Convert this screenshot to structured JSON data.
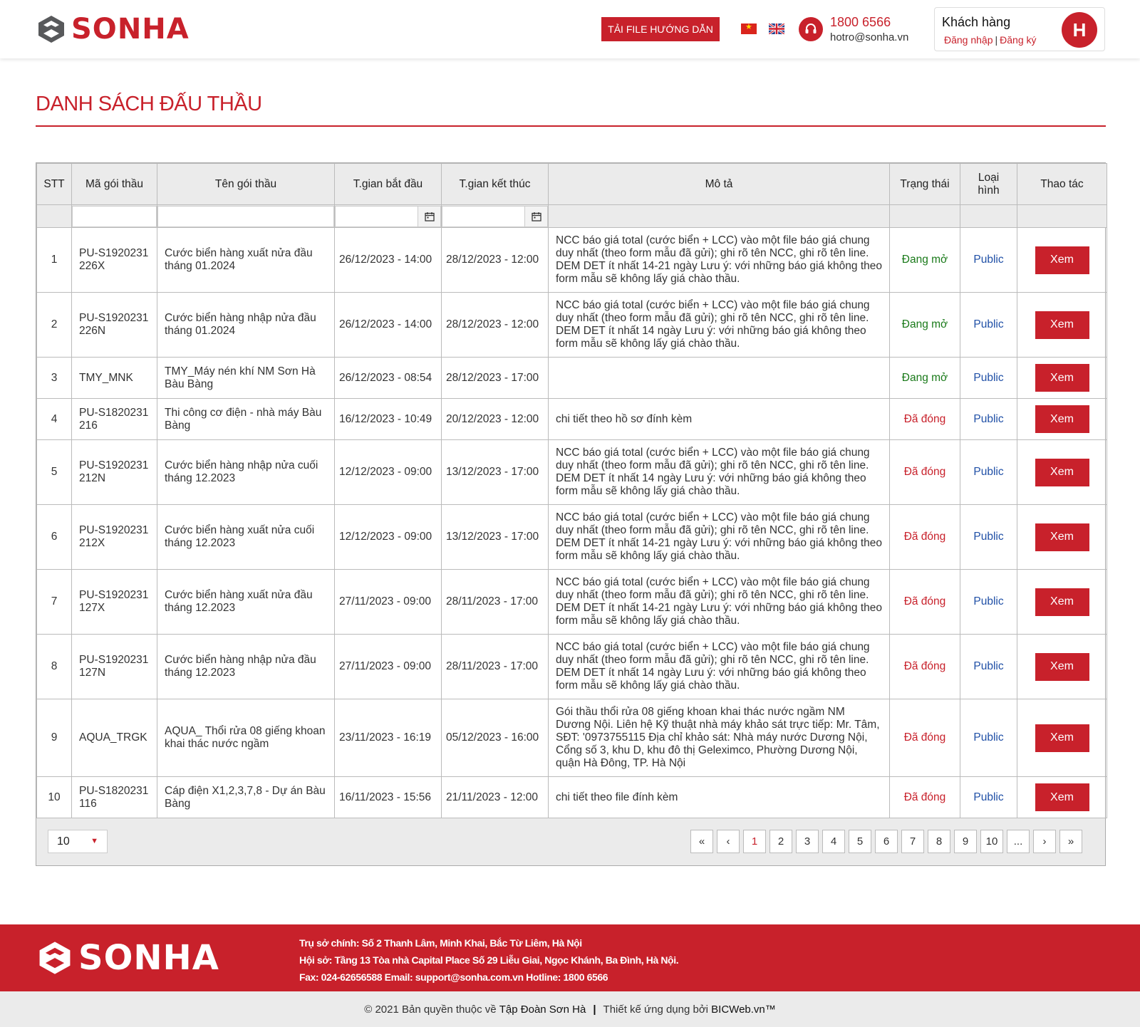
{
  "header": {
    "brand": "SONHA",
    "download_label": "TẢI FILE HƯỚNG DẪN",
    "phone": "1800 6566",
    "email": "hotro@sonha.vn",
    "user_title": "Khách hàng",
    "login_label": "Đăng nhập",
    "register_label": "Đăng ký",
    "avatar_letter": "H"
  },
  "page_title": "DANH SÁCH ĐẤU THẦU",
  "table": {
    "headers": [
      "STT",
      "Mã gói thầu",
      "Tên gói thầu",
      "T.gian bắt đầu",
      "T.gian kết thúc",
      "Mô tả",
      "Trạng thái",
      "Loại hình",
      "Thao tác"
    ],
    "view_label": "Xem",
    "rows": [
      {
        "stt": "1",
        "code": "PU-S1920231226X",
        "name": "Cước biển hàng xuất nửa đầu tháng 01.2024",
        "start": "26/12/2023 - 14:00",
        "end": "28/12/2023 - 12:00",
        "desc": "NCC báo giá total (cước biển + LCC) vào một file báo giá chung duy nhất (theo form mẫu đã gửi); ghi rõ tên NCC, ghi rõ tên line. DEM DET ít nhất 14-21 ngày Lưu ý: với những báo giá không theo form mẫu sẽ không lấy giá chào thầu.",
        "status": "Đang mở",
        "type": "Public"
      },
      {
        "stt": "2",
        "code": "PU-S1920231226N",
        "name": "Cước biển hàng nhập nửa đầu tháng 01.2024",
        "start": "26/12/2023 - 14:00",
        "end": "28/12/2023 - 12:00",
        "desc": "NCC báo giá total (cước biển + LCC) vào một file báo giá chung duy nhất (theo form mẫu đã gửi); ghi rõ tên NCC, ghi rõ tên line. DEM DET ít nhất 14 ngày Lưu ý: với những báo giá không theo form mẫu sẽ không lấy giá chào thầu.",
        "status": "Đang mở",
        "type": "Public"
      },
      {
        "stt": "3",
        "code": "TMY_MNK",
        "name": "TMY_Máy nén khí NM Sơn Hà Bàu Bàng",
        "start": "26/12/2023 - 08:54",
        "end": "28/12/2023 - 17:00",
        "desc": "",
        "status": "Đang mở",
        "type": "Public"
      },
      {
        "stt": "4",
        "code": "PU-S1820231216",
        "name": "Thi công cơ điện - nhà máy Bàu Bàng",
        "start": "16/12/2023 - 10:49",
        "end": "20/12/2023 - 12:00",
        "desc": "chi tiết theo hồ sơ đính kèm",
        "status": "Đã đóng",
        "type": "Public"
      },
      {
        "stt": "5",
        "code": "PU-S1920231212N",
        "name": "Cước biển hàng nhập nửa cuối tháng 12.2023",
        "start": "12/12/2023 - 09:00",
        "end": "13/12/2023 - 17:00",
        "desc": "NCC báo giá total (cước biển + LCC) vào một file báo giá chung duy nhất (theo form mẫu đã gửi); ghi rõ tên NCC, ghi rõ tên line. DEM DET ít nhất 14 ngày Lưu ý: với những báo giá không theo form mẫu sẽ không lấy giá chào thầu.",
        "status": "Đã đóng",
        "type": "Public"
      },
      {
        "stt": "6",
        "code": "PU-S1920231212X",
        "name": "Cước biển hàng xuất nửa cuối tháng 12.2023",
        "start": "12/12/2023 - 09:00",
        "end": "13/12/2023 - 17:00",
        "desc": "NCC báo giá total (cước biển + LCC) vào một file báo giá chung duy nhất (theo form mẫu đã gửi); ghi rõ tên NCC, ghi rõ tên line. DEM DET ít nhất 14-21 ngày Lưu ý: với những báo giá không theo form mẫu sẽ không lấy giá chào thầu.",
        "status": "Đã đóng",
        "type": "Public"
      },
      {
        "stt": "7",
        "code": "PU-S1920231127X",
        "name": "Cước biển hàng xuất nửa đầu tháng 12.2023",
        "start": "27/11/2023 - 09:00",
        "end": "28/11/2023 - 17:00",
        "desc": "NCC báo giá total (cước biển + LCC) vào một file báo giá chung duy nhất (theo form mẫu đã gửi); ghi rõ tên NCC, ghi rõ tên line. DEM DET ít nhất 14-21 ngày Lưu ý: với những báo giá không theo form mẫu sẽ không lấy giá chào thầu.",
        "status": "Đã đóng",
        "type": "Public"
      },
      {
        "stt": "8",
        "code": "PU-S1920231127N",
        "name": "Cước biển hàng nhập nửa đầu tháng 12.2023",
        "start": "27/11/2023 - 09:00",
        "end": "28/11/2023 - 17:00",
        "desc": "NCC báo giá total (cước biển + LCC) vào một file báo giá chung duy nhất (theo form mẫu đã gửi); ghi rõ tên NCC, ghi rõ tên line. DEM DET ít nhất 14 ngày Lưu ý: với những báo giá không theo form mẫu sẽ không lấy giá chào thầu.",
        "status": "Đã đóng",
        "type": "Public"
      },
      {
        "stt": "9",
        "code": "AQUA_TRGK",
        "name": "AQUA_ Thổi rửa 08 giếng khoan khai thác nước ngầm",
        "start": "23/11/2023 - 16:19",
        "end": "05/12/2023 - 16:00",
        "desc": "Gói thầu thổi rửa 08 giếng khoan khai thác nước ngầm NM Dương Nội. Liên hệ Kỹ thuật nhà máy khảo sát trực tiếp: Mr. Tâm, SĐT: '0973755115 Địa chỉ khảo sát: Nhà máy nước Dương Nội, Cổng số 3, khu D, khu đô thị Geleximco, Phường Dương Nội, quận Hà Đông, TP. Hà Nội",
        "status": "Đã đóng",
        "type": "Public"
      },
      {
        "stt": "10",
        "code": "PU-S1820231116",
        "name": "Cáp điện X1,2,3,7,8 - Dự án Bàu Bàng",
        "start": "16/11/2023 - 15:56",
        "end": "21/11/2023 - 12:00",
        "desc": "chi tiết theo file đính kèm",
        "status": "Đã đóng",
        "type": "Public"
      }
    ]
  },
  "pager": {
    "page_size": "10",
    "first": "«",
    "prev": "‹",
    "pages": [
      "1",
      "2",
      "3",
      "4",
      "5",
      "6",
      "7",
      "8",
      "9",
      "10",
      "..."
    ],
    "active_page": "1",
    "next": "›",
    "last": "»"
  },
  "footer": {
    "brand": "SONHA",
    "line1": "Trụ sở chính: Số 2 Thanh Lâm, Minh Khai, Bắc Từ Liêm, Hà Nội",
    "line2": "Hội sở: Tầng 13 Tòa nhà Capital Place Số 29 Liễu Giai, Ngọc Khánh, Ba Đình, Hà Nội.",
    "line3": "Fax: 024-62656588 Email: support@sonha.com.vn Hotline: 1800 6566",
    "copyright_prefix": "© 2021 Bản quyền thuộc về",
    "company": "Tập Đoàn Sơn Hà",
    "designed_prefix": "Thiết kế ứng dụng bởi",
    "designer": "BICWeb.vn™"
  }
}
